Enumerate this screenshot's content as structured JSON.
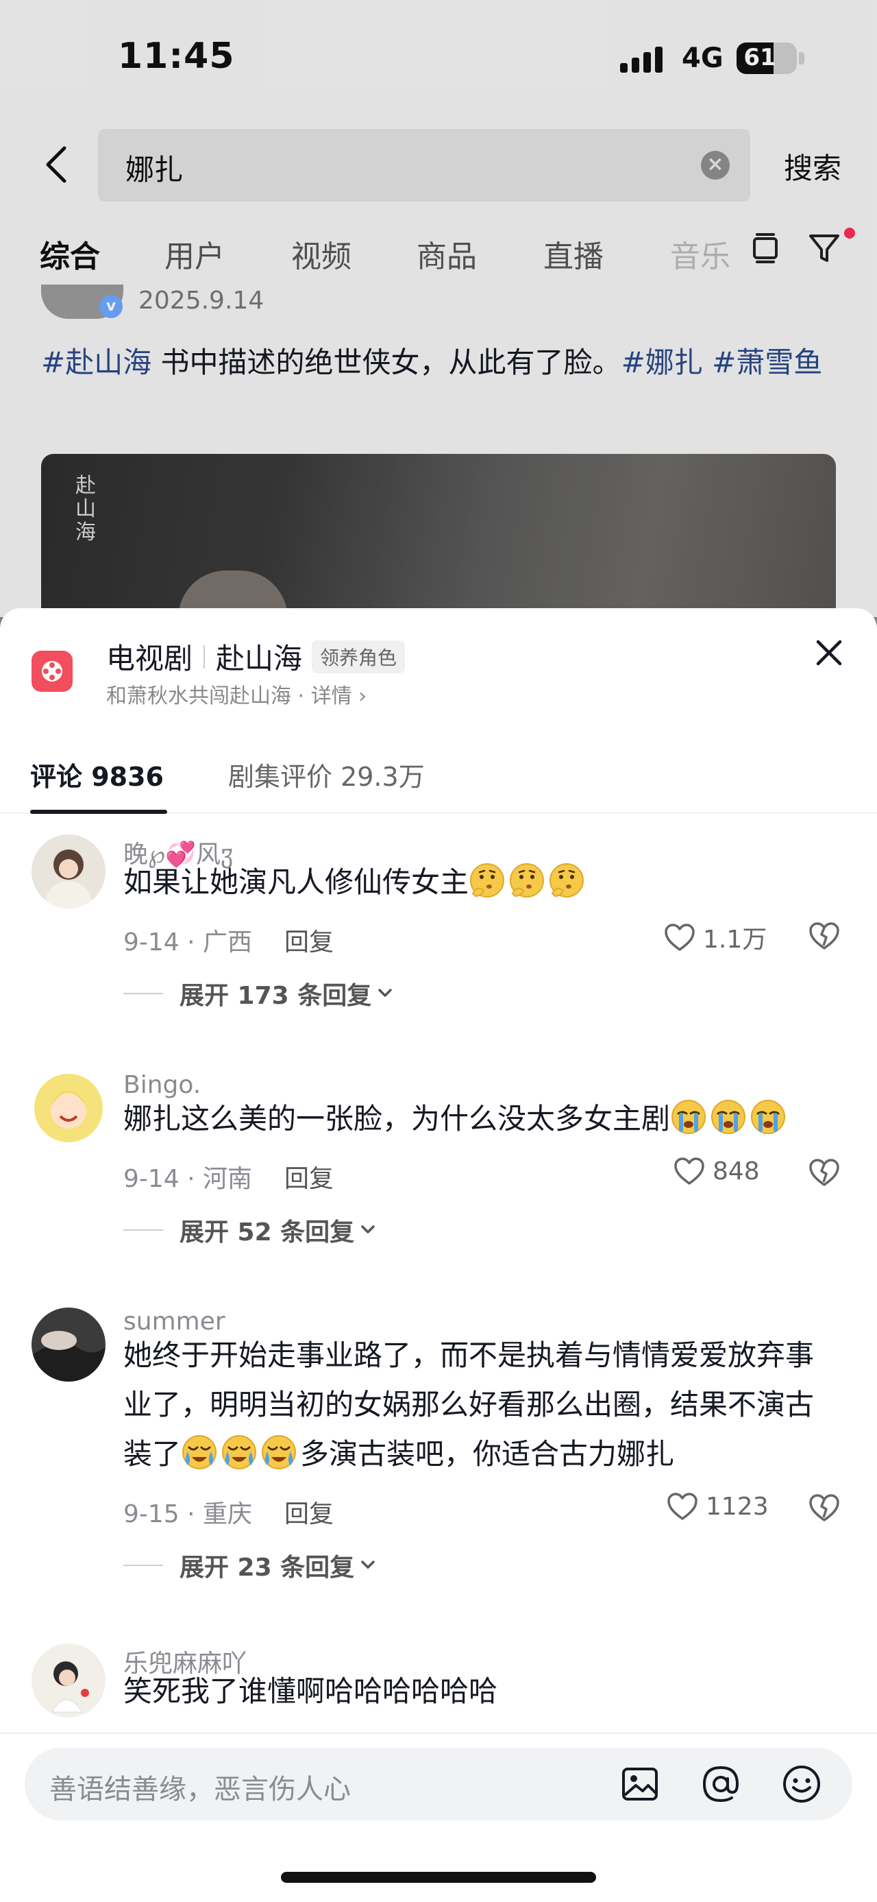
{
  "status_bar": {
    "time": "11:45",
    "network": "4G",
    "battery": "61",
    "battery_level": 0.61
  },
  "search": {
    "query": "娜扎",
    "search_label": "搜索"
  },
  "top_tabs": [
    {
      "label": "综合",
      "active": true
    },
    {
      "label": "用户"
    },
    {
      "label": "视频"
    },
    {
      "label": "商品"
    },
    {
      "label": "直播"
    },
    {
      "label": "音乐"
    }
  ],
  "post": {
    "date": "2025.9.14",
    "tag1": "#赴山海",
    "text": " 书中描述的绝世侠女，从此有了脸。",
    "tag2": "#娜扎",
    "tag3": "#萧雪鱼",
    "media_title": "赴山海"
  },
  "sheet": {
    "category": "电视剧",
    "title": "赴山海",
    "tag": "领养角色",
    "subtitle": "和萧秋水共闯赴山海 · 详情 ›",
    "tabs": [
      {
        "label": "评论 9836",
        "active": true
      },
      {
        "label": "剧集评价 29.3万"
      }
    ]
  },
  "comments": [
    {
      "user": "晚℘💞风ჳ",
      "text": "如果让她演凡人修仙传女主",
      "emoji": "thinking",
      "emoji_count": 3,
      "date_loc": "9-14 · 广西",
      "reply": "回复",
      "likes": "1.1万",
      "expand": "展开 173 条回复"
    },
    {
      "user": "Bingo.",
      "text": "娜扎这么美的一张脸，为什么没太多女主剧",
      "emoji": "crying",
      "emoji_count": 3,
      "date_loc": "9-14 · 河南",
      "reply": "回复",
      "likes": "848",
      "expand": "展开 52 条回复"
    },
    {
      "user": "summer",
      "text_line1": "她终于开始走事业路了，而不是执着与情情爱爱放弃事",
      "text_line2": "业了，明明当初的女娲那么好看那么出圈，结果不演古",
      "text_line3_pre": "装了",
      "text_line3_post": "多演古装吧，你适合古力娜扎",
      "emoji": "sobbing",
      "emoji_count": 3,
      "date_loc": "9-15 · 重庆",
      "reply": "回复",
      "likes": "1123",
      "expand": "展开 23 条回复"
    },
    {
      "user": "乐兜麻麻吖",
      "text": "笑死我了谁懂啊哈哈哈哈哈哈"
    }
  ],
  "input": {
    "placeholder": "善语结善缘，恶言伤人心"
  },
  "colors": {
    "accent": "#fe2c55",
    "hashtag": "#2b4a8a",
    "logo": "#f24e5e",
    "text": "#161823",
    "muted": "#8a8b91"
  }
}
